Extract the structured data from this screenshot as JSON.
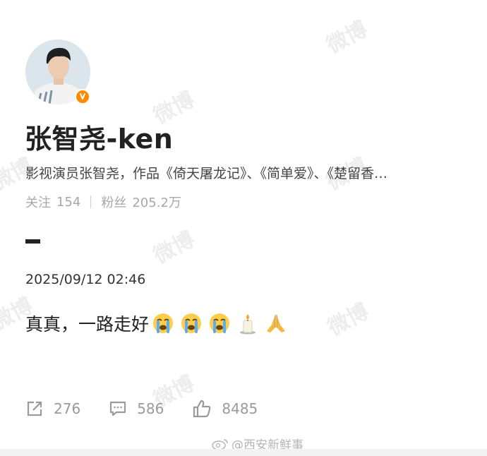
{
  "watermark": {
    "text": "微博"
  },
  "profile": {
    "name": "张智尧-ken",
    "bio": "影视演员张智尧，作品《倚天屠龙记》、《简单爱》、《楚留香…",
    "following_label": "关注",
    "following_count": "154",
    "fans_label": "粉丝",
    "fans_count": "205.2万",
    "verified_color": "#ff8a00",
    "avatar_icon": "avatar-photo"
  },
  "post": {
    "timestamp": "2025/09/12 02:46",
    "text": "真真，一路走好",
    "emojis": [
      "crying-face-icon",
      "crying-face-icon",
      "crying-face-icon",
      "candle-icon",
      "folded-hands-icon"
    ]
  },
  "actions": {
    "repost_count": "276",
    "comment_count": "586",
    "like_count": "8485"
  },
  "source": {
    "text": "@西安新鲜事"
  }
}
